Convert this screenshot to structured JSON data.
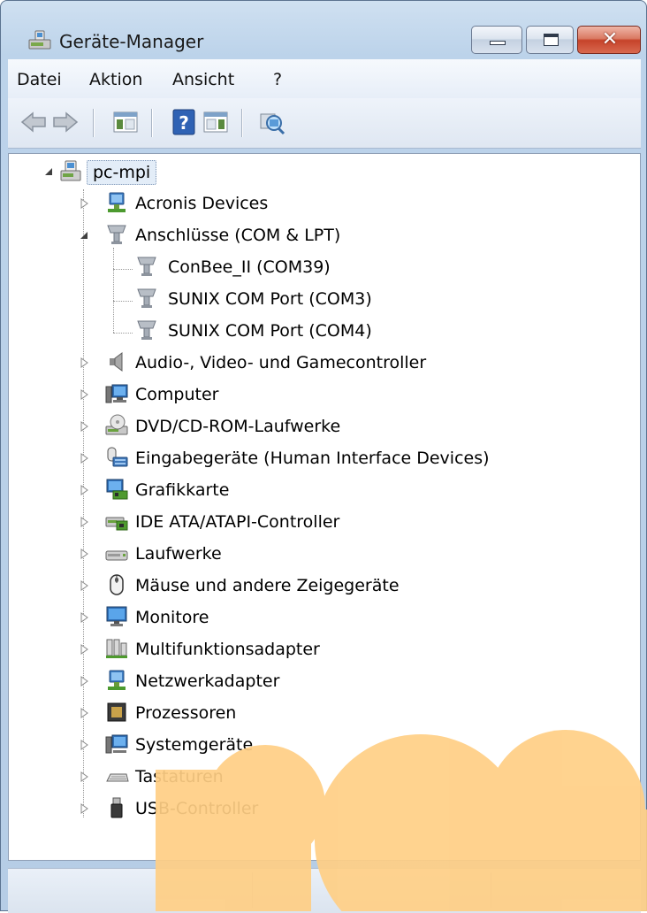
{
  "window": {
    "title": "Geräte-Manager",
    "title_icon": "device-manager-icon",
    "close_glyph": "✕"
  },
  "menu": [
    {
      "label": "Datei"
    },
    {
      "label": "Aktion"
    },
    {
      "label": "Ansicht"
    },
    {
      "label": "?"
    }
  ],
  "toolbar": [
    {
      "name": "back-button",
      "icon": "arrow-left-icon"
    },
    {
      "name": "forward-button",
      "icon": "arrow-right-icon"
    },
    {
      "name": "show-hide-console-tree-button",
      "icon": "console-tree-icon"
    },
    {
      "name": "help-button",
      "icon": "help-icon"
    },
    {
      "name": "show-hide-action-pane-button",
      "icon": "action-pane-icon"
    },
    {
      "name": "scan-hardware-button",
      "icon": "scan-hardware-icon"
    }
  ],
  "tree": {
    "root": {
      "label": "pc-mpi",
      "icon": "computer-tree-icon",
      "expanded": true
    },
    "categories": [
      {
        "label": "Acronis Devices",
        "icon": "network-adapter-icon",
        "expanded": false
      },
      {
        "label": "Anschlüsse (COM & LPT)",
        "icon": "port-icon",
        "expanded": true,
        "children": [
          {
            "label": "ConBee_II (COM39)",
            "icon": "port-icon"
          },
          {
            "label": "SUNIX COM Port (COM3)",
            "icon": "port-icon"
          },
          {
            "label": "SUNIX COM Port (COM4)",
            "icon": "port-icon"
          }
        ]
      },
      {
        "label": "Audio-, Video- und Gamecontroller",
        "icon": "speaker-icon",
        "expanded": false
      },
      {
        "label": "Computer",
        "icon": "computer-icon",
        "expanded": false
      },
      {
        "label": "DVD/CD-ROM-Laufwerke",
        "icon": "dvd-drive-icon",
        "expanded": false
      },
      {
        "label": "Eingabegeräte (Human Interface Devices)",
        "icon": "hid-icon",
        "expanded": false
      },
      {
        "label": "Grafikkarte",
        "icon": "display-adapter-icon",
        "expanded": false
      },
      {
        "label": "IDE ATA/ATAPI-Controller",
        "icon": "ide-controller-icon",
        "expanded": false
      },
      {
        "label": "Laufwerke",
        "icon": "disk-drive-icon",
        "expanded": false
      },
      {
        "label": "Mäuse und andere Zeigegeräte",
        "icon": "mouse-icon",
        "expanded": false
      },
      {
        "label": "Monitore",
        "icon": "monitor-icon",
        "expanded": false
      },
      {
        "label": "Multifunktionsadapter",
        "icon": "multifunction-adapter-icon",
        "expanded": false
      },
      {
        "label": "Netzwerkadapter",
        "icon": "network-adapter-icon",
        "expanded": false
      },
      {
        "label": "Prozessoren",
        "icon": "processor-icon",
        "expanded": false
      },
      {
        "label": "Systemgeräte",
        "icon": "system-devices-icon",
        "expanded": false
      },
      {
        "label": "Tastaturen",
        "icon": "keyboard-icon",
        "expanded": false
      },
      {
        "label": "USB-Controller",
        "icon": "usb-icon",
        "expanded": false
      }
    ]
  },
  "statusbar": {
    "panes": [
      "",
      "",
      ""
    ]
  },
  "colors": {
    "watermark": "#ffcf85",
    "accent": "#3c7fb1",
    "close": "#c6432a"
  }
}
